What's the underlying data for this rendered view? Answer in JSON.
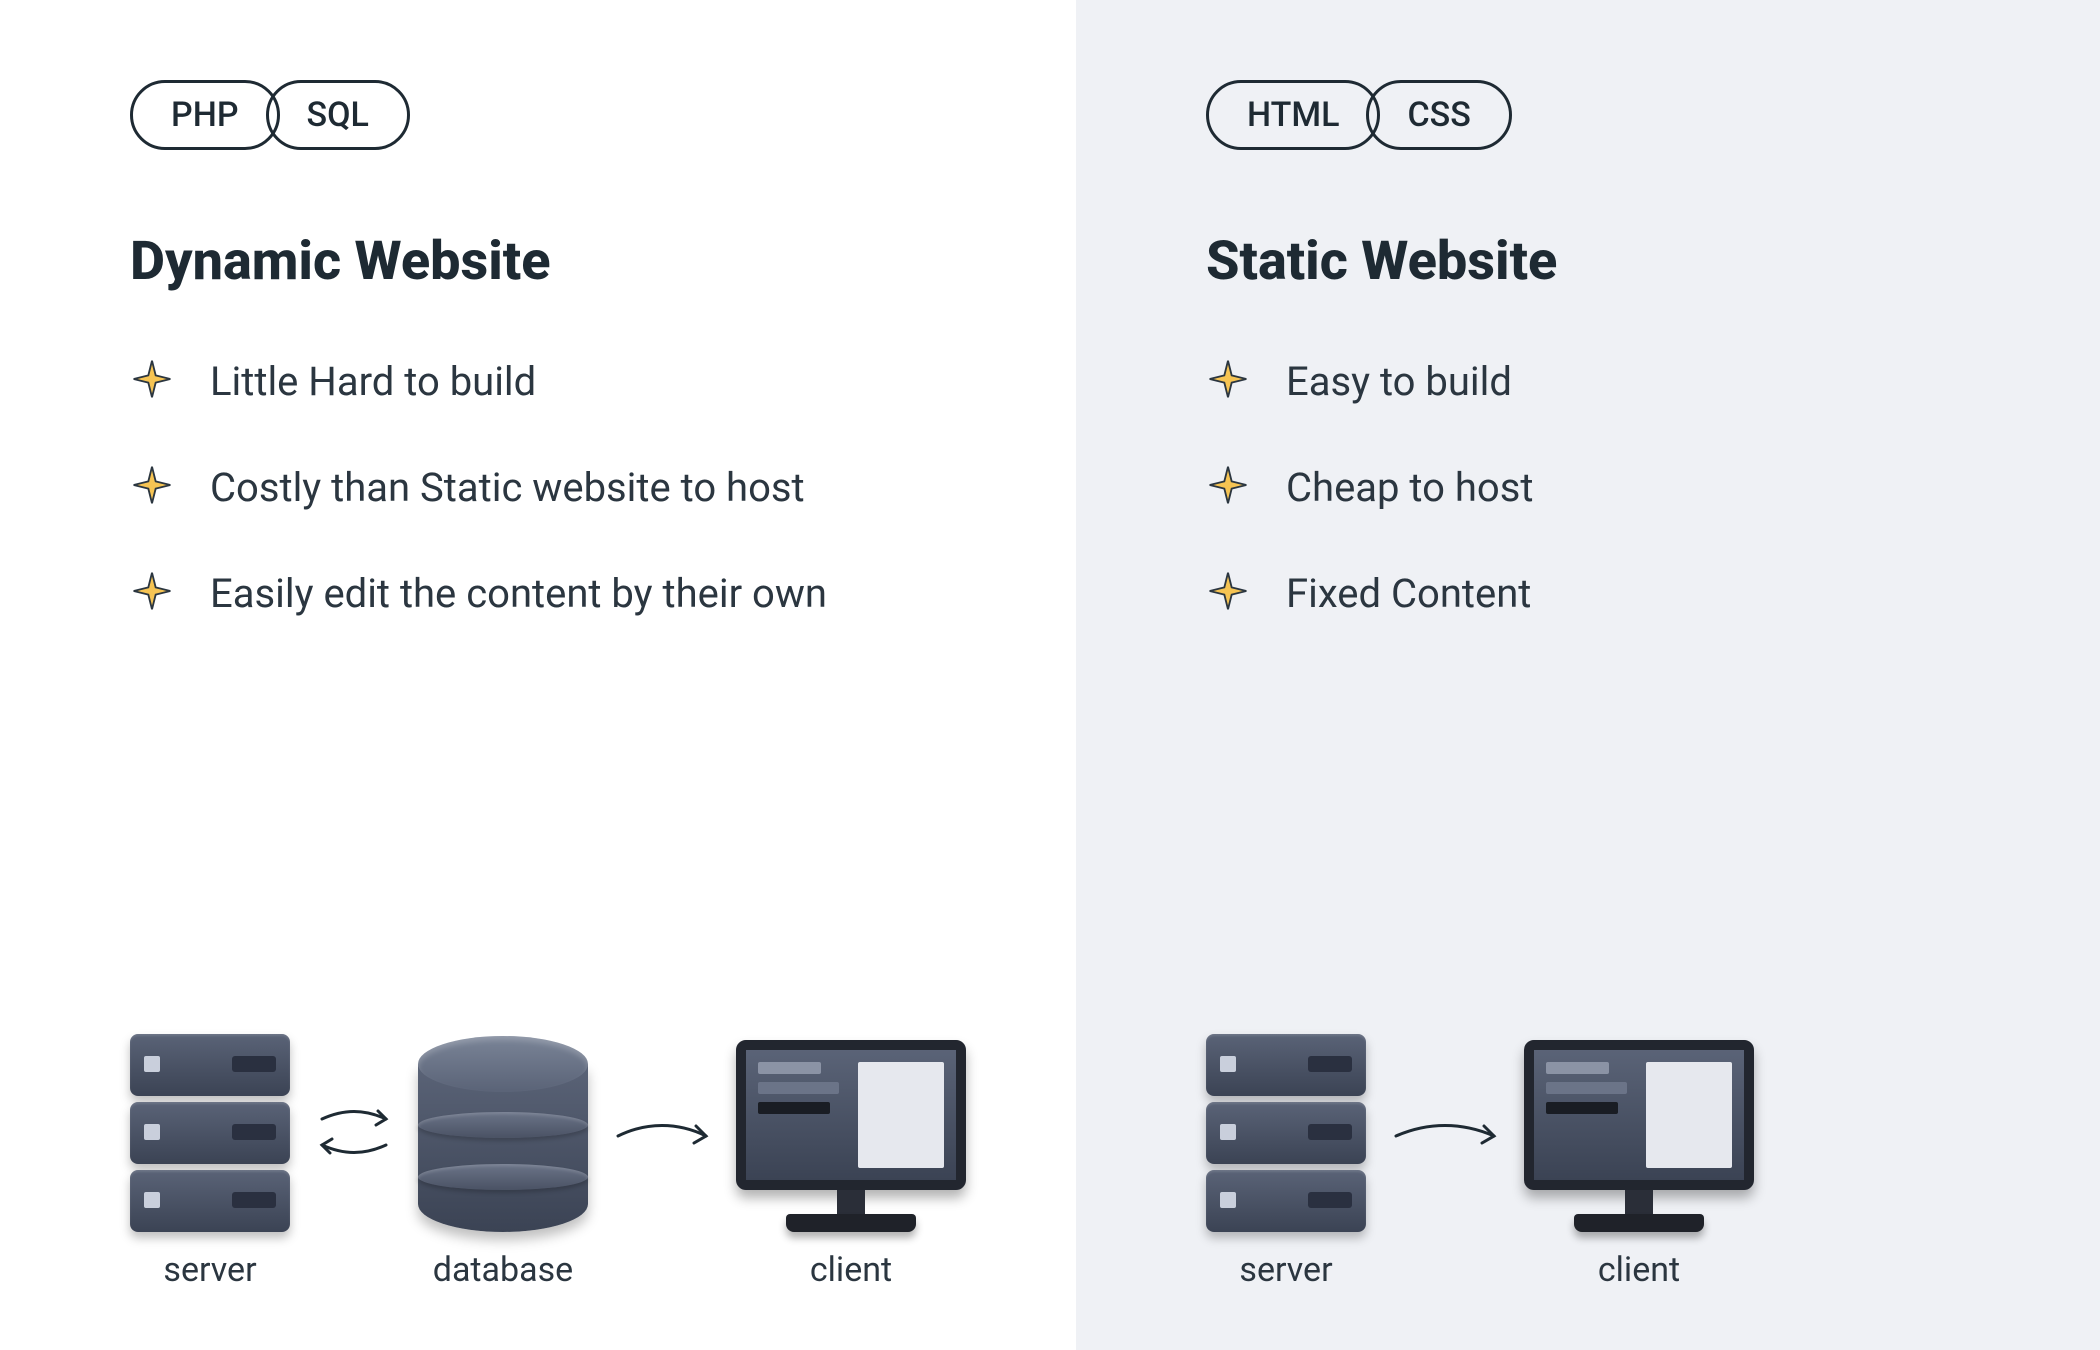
{
  "left": {
    "pills": [
      "PHP",
      "SQL"
    ],
    "heading": "Dynamic Website",
    "bullets": [
      "Little Hard to build",
      "Costly than Static website to host",
      "Easily edit the content by their own"
    ],
    "nodes": {
      "server": "server",
      "database": "database",
      "client": "client"
    }
  },
  "right": {
    "pills": [
      "HTML",
      "CSS"
    ],
    "heading": "Static Website",
    "bullets": [
      "Easy to build",
      "Cheap to host",
      "Fixed Content"
    ],
    "nodes": {
      "server": "server",
      "client": "client"
    }
  }
}
